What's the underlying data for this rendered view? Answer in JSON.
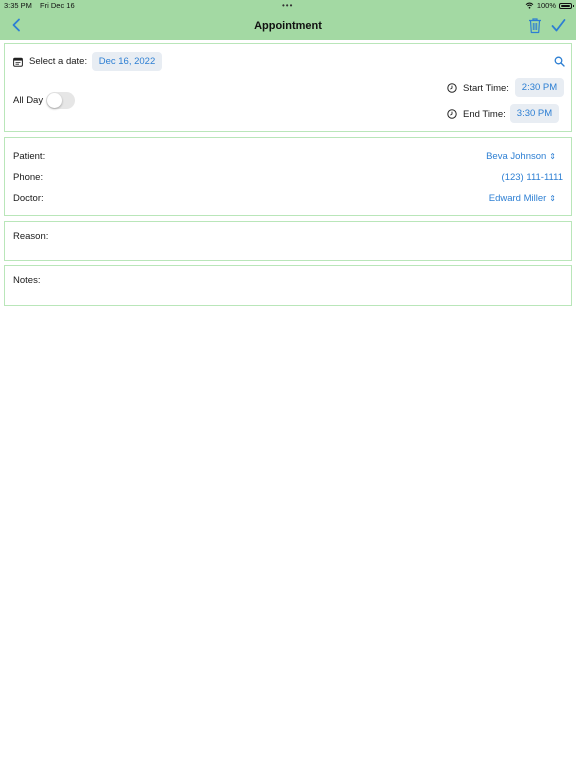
{
  "status_bar": {
    "time": "3:35 PM",
    "date": "Fri Dec 16",
    "battery": "100%"
  },
  "nav": {
    "title": "Appointment"
  },
  "schedule": {
    "date_label": "Select a date:",
    "date_value": "Dec 16, 2022",
    "all_day_label": "All Day",
    "all_day_on": false,
    "start_label": "Start Time:",
    "start_value": "2:30 PM",
    "end_label": "End Time:",
    "end_value": "3:30 PM"
  },
  "details": {
    "patient_label": "Patient:",
    "patient_value": "Beva Johnson",
    "phone_label": "Phone:",
    "phone_value": "(123) 111-1111",
    "doctor_label": "Doctor:",
    "doctor_value": "Edward Miller"
  },
  "reason": {
    "label": "Reason:",
    "value": ""
  },
  "notes": {
    "label": "Notes:",
    "value": ""
  },
  "colors": {
    "header_bg": "#a3d9a3",
    "accent": "#2d7fd3",
    "card_border": "#b9e6b9"
  }
}
